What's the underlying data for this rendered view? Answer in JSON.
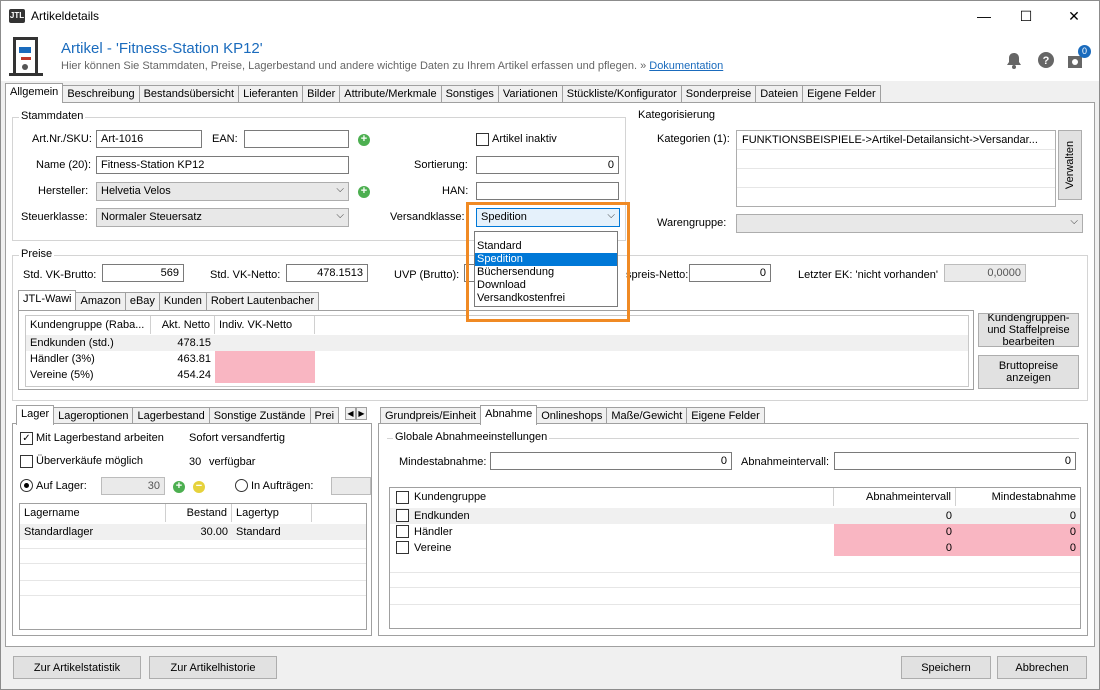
{
  "window": {
    "app_icon": "JTL",
    "title": "Artikeldetails",
    "minimize": "—",
    "maximize": "☐",
    "close": "✕"
  },
  "header": {
    "title": "Artikel - 'Fitness-Station KP12'",
    "subtitle": "Hier können Sie Stammdaten, Preise, Lagerbestand und andere wichtige Daten zu Ihrem Artikel erfassen und pflegen. »",
    "doc_link": "Dokumentation",
    "badge": "0"
  },
  "main_tabs": [
    "Allgemein",
    "Beschreibung",
    "Bestandsübersicht",
    "Lieferanten",
    "Bilder",
    "Attribute/Merkmale",
    "Sonstiges",
    "Variationen",
    "Stückliste/Konfigurator",
    "Sonderpreise",
    "Dateien",
    "Eigene Felder"
  ],
  "stammdaten": {
    "title": "Stammdaten",
    "artnr_label": "Art.Nr./SKU:",
    "artnr_value": "Art-1016",
    "ean_label": "EAN:",
    "ean_value": "",
    "inaktiv_label": "Artikel inaktiv",
    "name_label": "Name (20):",
    "name_value": "Fitness-Station KP12",
    "sortierung_label": "Sortierung:",
    "sortierung_value": "0",
    "hersteller_label": "Hersteller:",
    "hersteller_value": "Helvetia Velos",
    "han_label": "HAN:",
    "han_value": "",
    "steuer_label": "Steuerklasse:",
    "steuer_value": "Normaler Steuersatz",
    "versand_label": "Versandklasse:",
    "versand_value": "Spedition",
    "versand_options": [
      "Standard",
      "Spedition",
      "Büchersendung",
      "Download",
      "Versandkostenfrei"
    ]
  },
  "kategorisierung": {
    "title": "Kategorisierung",
    "kategorien_label": "Kategorien (1):",
    "kategorien_value": "FUNKTIONSBEISPIELE->Artikel-Detailansicht->Versandar...",
    "verwalten": "Verwalten",
    "warengruppe_label": "Warengruppe:",
    "warengruppe_value": ""
  },
  "preise": {
    "title": "Preise",
    "vk_brutto_label": "Std. VK-Brutto:",
    "vk_brutto_value": "569",
    "vk_netto_label": "Std. VK-Netto:",
    "vk_netto_value": "478.1513",
    "uvp_label": "UVP (Brutto):",
    "ek_netto_label": "spreis-Netto:",
    "ek_netto_value": "0",
    "letzter_ek_label": "Letzter EK: 'nicht vorhanden'",
    "letzter_ek_value": "0,0000",
    "tabs": [
      "JTL-Wawi",
      "Amazon",
      "eBay",
      "Kunden",
      "Robert Lautenbacher"
    ],
    "columns": [
      "Kundengruppe (Raba...",
      "Akt. Netto",
      "Indiv. VK-Netto"
    ],
    "rows": [
      {
        "group": "Endkunden (std.)",
        "netto": "478.15",
        "indiv": ""
      },
      {
        "group": "Händler (3%)",
        "netto": "463.81",
        "indiv": ""
      },
      {
        "group": "Vereine (5%)",
        "netto": "454.24",
        "indiv": ""
      }
    ],
    "staffel_button": "Kundengruppen- und Staffelpreise bearbeiten",
    "brutto_button": "Bruttopreise anzeigen"
  },
  "lager": {
    "tabs": [
      "Lager",
      "Lageroptionen",
      "Lagerbestand",
      "Sonstige Zustände",
      "Prei"
    ],
    "mit_lager_label": "Mit Lagerbestand arbeiten",
    "sofort_label": "Sofort versandfertig",
    "ueberverkauf_label": "Überverkäufe möglich",
    "verfuegbar_count": "30",
    "verfuegbar_label": "verfügbar",
    "auf_lager_label": "Auf Lager:",
    "auf_lager_value": "30",
    "in_auftraegen_label": "In Aufträgen:",
    "columns": [
      "Lagername",
      "Bestand",
      "Lagertyp"
    ],
    "rows": [
      {
        "name": "Standardlager",
        "bestand": "30.00",
        "typ": "Standard"
      }
    ]
  },
  "abnahme": {
    "tabs": [
      "Grundpreis/Einheit",
      "Abnahme",
      "Onlineshops",
      "Maße/Gewicht",
      "Eigene Felder"
    ],
    "group_title": "Globale Abnahmeeinstellungen",
    "mindest_label": "Mindestabnahme:",
    "mindest_value": "0",
    "intervall_label": "Abnahmeintervall:",
    "intervall_value": "0",
    "columns": [
      "Kundengruppe",
      "Abnahmeintervall",
      "Mindestabnahme"
    ],
    "rows": [
      {
        "group": "Endkunden",
        "intervall": "0",
        "mindest": "0"
      },
      {
        "group": "Händler",
        "intervall": "0",
        "mindest": "0"
      },
      {
        "group": "Vereine",
        "intervall": "0",
        "mindest": "0"
      }
    ]
  },
  "footer": {
    "statistik": "Zur Artikelstatistik",
    "historie": "Zur Artikelhistorie",
    "speichern": "Speichern",
    "abbrechen": "Abbrechen"
  },
  "colors": {
    "accent": "#1a6bbd",
    "highlight": "#f08a24",
    "pink": "#f9b6c2",
    "selection": "#0078d7"
  }
}
